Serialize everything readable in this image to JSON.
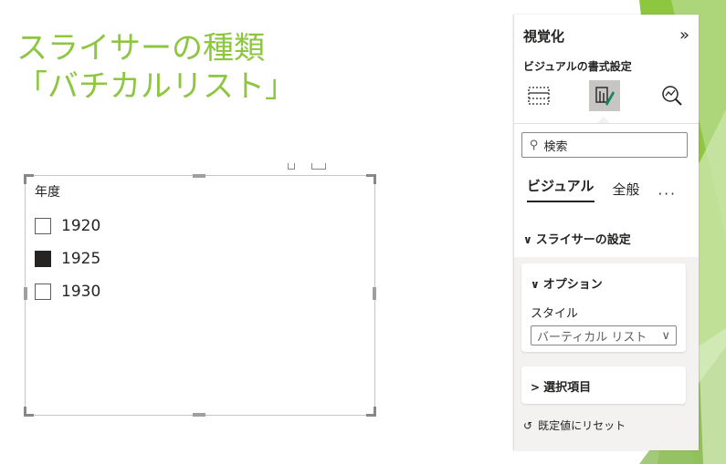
{
  "slide": {
    "title_line1": "スライサーの種類",
    "title_line2": "「バチカルリスト」"
  },
  "slicer": {
    "header": "年度",
    "items": [
      {
        "label": "1920",
        "checked": false
      },
      {
        "label": "1925",
        "checked": true
      },
      {
        "label": "1930",
        "checked": false
      }
    ]
  },
  "pane": {
    "title": "視覚化",
    "expand_icon": "double-chevron-right-icon",
    "subtitle": "ビジュアルの書式設定",
    "format_tabs": [
      {
        "icon": "build-visual-icon",
        "active": false
      },
      {
        "icon": "format-visual-icon",
        "active": true
      },
      {
        "icon": "analytics-icon",
        "active": false
      }
    ],
    "search_placeholder": "検索",
    "tabs": [
      {
        "label": "ビジュアル",
        "active": true
      },
      {
        "label": "全般",
        "active": false
      }
    ],
    "more": "···",
    "section": "スライサーの設定",
    "options_card": {
      "title": "オプション",
      "style_label": "スタイル",
      "style_value": "バーティカル リスト"
    },
    "selection_card": {
      "title": "選択項目"
    },
    "reset": "既定値にリセット"
  },
  "colors": {
    "title_green": "#8dc63f",
    "checked_fill": "#252423",
    "pane_bg": "#f3f2f1"
  }
}
